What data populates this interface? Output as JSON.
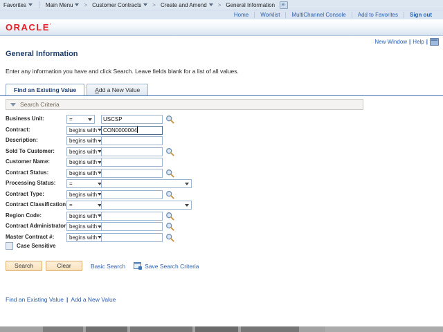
{
  "breadcrumb": {
    "favorites": "Favorites",
    "items": [
      {
        "label": "Main Menu",
        "arrow": true
      },
      {
        "label": "Customer Contracts",
        "arrow": true
      },
      {
        "label": "Create and Amend",
        "arrow": true
      },
      {
        "label": "General Information",
        "arrow": false,
        "icon": "page-popup-icon"
      }
    ]
  },
  "header": {
    "logo": "ORACLE",
    "links": [
      "Home",
      "Worklist",
      "MultiChannel Console",
      "Add to Favorites"
    ],
    "signout": "Sign out"
  },
  "page_links": {
    "new_window": "New Window",
    "help": "Help",
    "separator": "|"
  },
  "main": {
    "title": "General Information",
    "instruction": "Enter any information you have and click Search. Leave fields blank for a list of all values.",
    "tabs": [
      {
        "label": "Find an Existing Value",
        "active": true
      },
      {
        "label": "Add a New Value",
        "active": false,
        "hotkey": "A"
      }
    ],
    "search_criteria_label": "Search Criteria"
  },
  "fields": [
    {
      "label": "Business Unit:",
      "operator": "=",
      "op_narrow": true,
      "control": "input",
      "value": "USCSP",
      "lookup": true,
      "focused": false
    },
    {
      "label": "Contract:",
      "operator": "begins with",
      "op_narrow": false,
      "control": "input",
      "value": "CON0000004",
      "lookup": false,
      "focused": true
    },
    {
      "label": "Description:",
      "operator": "begins with",
      "op_narrow": false,
      "control": "input",
      "value": "",
      "lookup": false,
      "focused": false
    },
    {
      "label": "Sold To Customer:",
      "operator": "begins with",
      "op_narrow": false,
      "control": "input",
      "value": "",
      "lookup": true,
      "focused": false
    },
    {
      "label": "Customer Name:",
      "operator": "begins with",
      "op_narrow": false,
      "control": "input",
      "value": "",
      "lookup": false,
      "focused": false
    },
    {
      "label": "Contract Status:",
      "operator": "begins with",
      "op_narrow": false,
      "control": "input",
      "value": "",
      "lookup": true,
      "focused": false
    },
    {
      "label": "Processing Status:",
      "operator": "=",
      "op_narrow": false,
      "control": "select",
      "value": "",
      "lookup": false,
      "focused": false
    },
    {
      "label": "Contract Type:",
      "operator": "begins with",
      "op_narrow": false,
      "control": "input",
      "value": "",
      "lookup": true,
      "focused": false
    },
    {
      "label": "Contract Classification:",
      "operator": "=",
      "op_narrow": false,
      "control": "select",
      "value": "",
      "lookup": false,
      "focused": false
    },
    {
      "label": "Region Code:",
      "operator": "begins with",
      "op_narrow": false,
      "control": "input",
      "value": "",
      "lookup": true,
      "focused": false
    },
    {
      "label": "Contract Administrator:",
      "operator": "begins with",
      "op_narrow": false,
      "control": "input",
      "value": "",
      "lookup": true,
      "focused": false
    },
    {
      "label": "Master Contract #:",
      "operator": "begins with",
      "op_narrow": false,
      "control": "input",
      "value": "",
      "lookup": true,
      "focused": false
    }
  ],
  "case_sensitive_label": "Case Sensitive",
  "actions": {
    "search": "Search",
    "clear": "Clear",
    "basic_search": "Basic Search",
    "save_search": "Save Search Criteria"
  },
  "bottom_links": [
    "Find an Existing Value",
    "Add a New Value"
  ],
  "colors": {
    "link_blue": "#2a5db0",
    "title_blue": "#1c3e6e",
    "logo_red": "#e21f26",
    "button_tan": "#f9e2bd",
    "bar_blue": "#dde7f2",
    "tab_line": "#4276b5"
  }
}
